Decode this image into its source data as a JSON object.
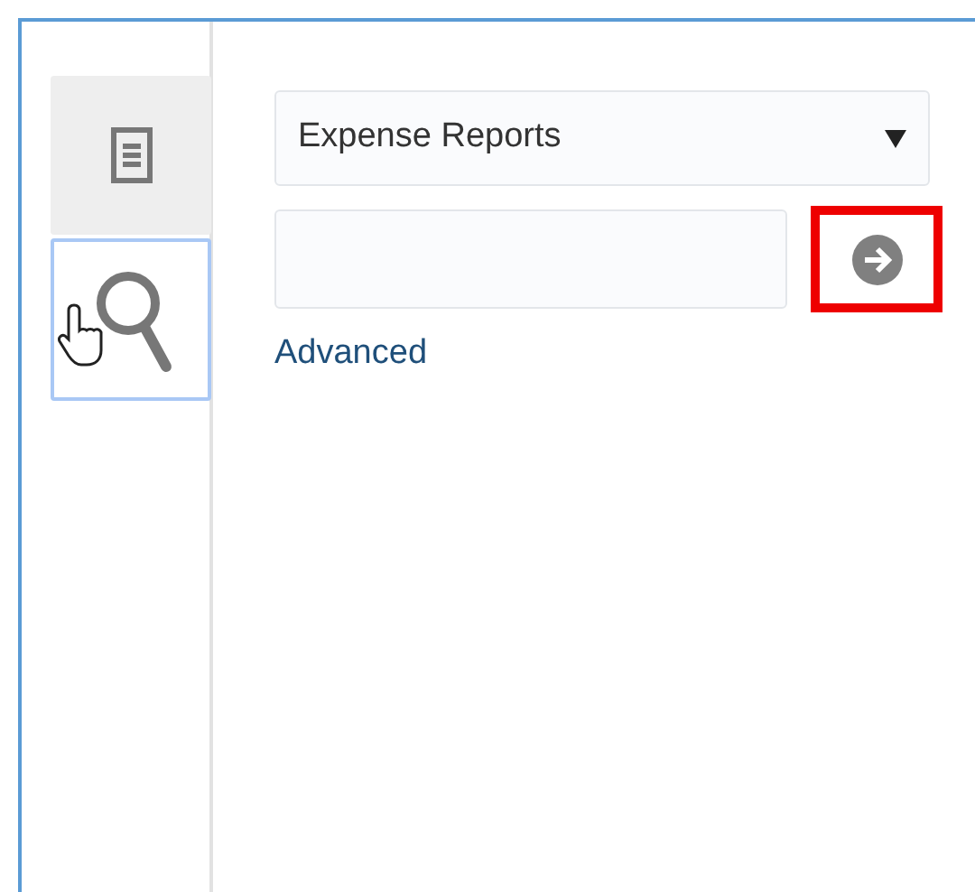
{
  "tabs": [
    {
      "kind": "document",
      "selected": false
    },
    {
      "kind": "search",
      "selected": true
    }
  ],
  "search": {
    "category_dropdown": {
      "value": "Expense Reports"
    },
    "go_button": {
      "highlighted": true
    },
    "advanced_link": "Advanced"
  }
}
